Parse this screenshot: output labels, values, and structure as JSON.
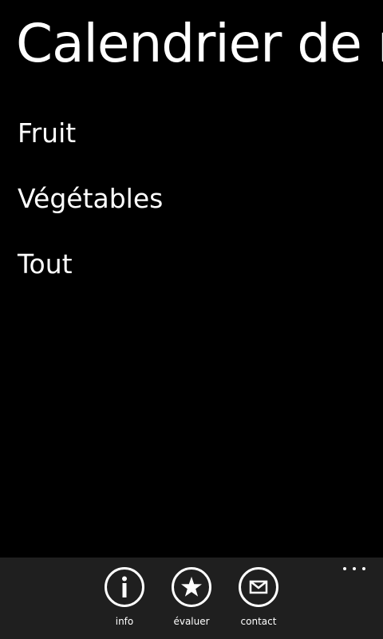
{
  "header": {
    "title": "Calendrier de r"
  },
  "menu": {
    "items": [
      {
        "label": "Fruit"
      },
      {
        "label": "Végétables"
      },
      {
        "label": "Tout"
      }
    ]
  },
  "appbar": {
    "buttons": [
      {
        "label": "info",
        "icon": "info-icon"
      },
      {
        "label": "évaluer",
        "icon": "star-icon"
      },
      {
        "label": "contact",
        "icon": "mail-icon"
      }
    ],
    "more_icon": "ellipsis-icon"
  },
  "colors": {
    "background": "#000000",
    "appbar_background": "#1f1f1f",
    "text": "#ffffff"
  }
}
